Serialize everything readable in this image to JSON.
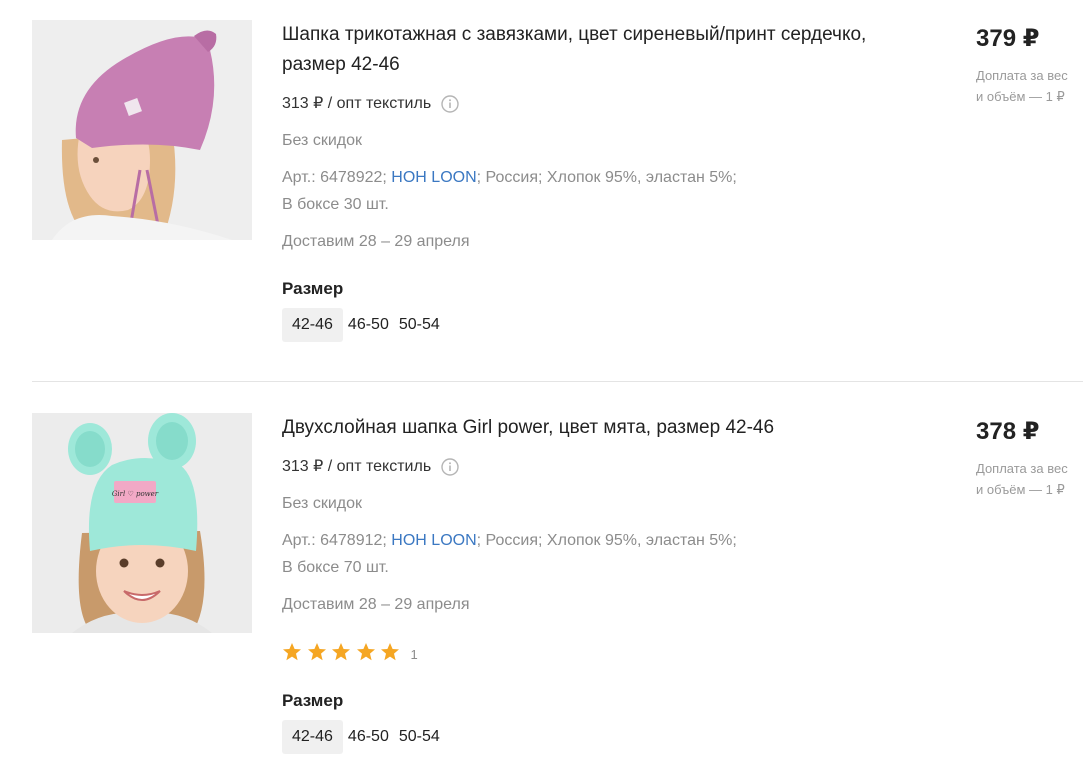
{
  "products": [
    {
      "title": "Шапка трикотажная с завязками, цвет сиреневый/принт сердечко, размер 42-46",
      "wholesale": "313 ₽ / опт текстиль",
      "discount": "Без скидок",
      "art_prefix": "Арт.: 6478922; ",
      "brand": "HOH LOON",
      "art_suffix": "; Россия; Хлопок 95%, эластан 5%;",
      "box": "В боксе 30 шт.",
      "delivery": "Доставим 28 – 29 апреля",
      "size_label": "Размер",
      "sizes": [
        "42-46",
        "46-50",
        "50-54"
      ],
      "selected_size": "42-46",
      "price": "379 ₽",
      "surcharge_line1": "Доплата за вес",
      "surcharge_line2": "и объём — 1 ₽",
      "image_color": "#c77fb3"
    },
    {
      "title": "Двухслойная шапка Girl power, цвет мята, размер 42-46",
      "wholesale": "313 ₽ / опт текстиль",
      "discount": "Без скидок",
      "art_prefix": "Арт.: 6478912; ",
      "brand": "HOH LOON",
      "art_suffix": "; Россия; Хлопок 95%, эластан 5%;",
      "box": "В боксе 70 шт.",
      "delivery": "Доставим 28 – 29 апреля",
      "rating_stars": 5,
      "rating_count": "1",
      "size_label": "Размер",
      "sizes": [
        "42-46",
        "46-50",
        "50-54"
      ],
      "selected_size": "42-46",
      "price": "378 ₽",
      "surcharge_line1": "Доплата за вес",
      "surcharge_line2": "и объём — 1 ₽",
      "image_color": "#9ee8d9",
      "image_badge_text": "Girl ♡ power"
    }
  ],
  "colors": {
    "brand_link": "#3b78c2",
    "star": "#f5a623",
    "muted_text": "#8c8c8c"
  },
  "icons": {
    "info": "info-icon",
    "star": "star-icon"
  }
}
